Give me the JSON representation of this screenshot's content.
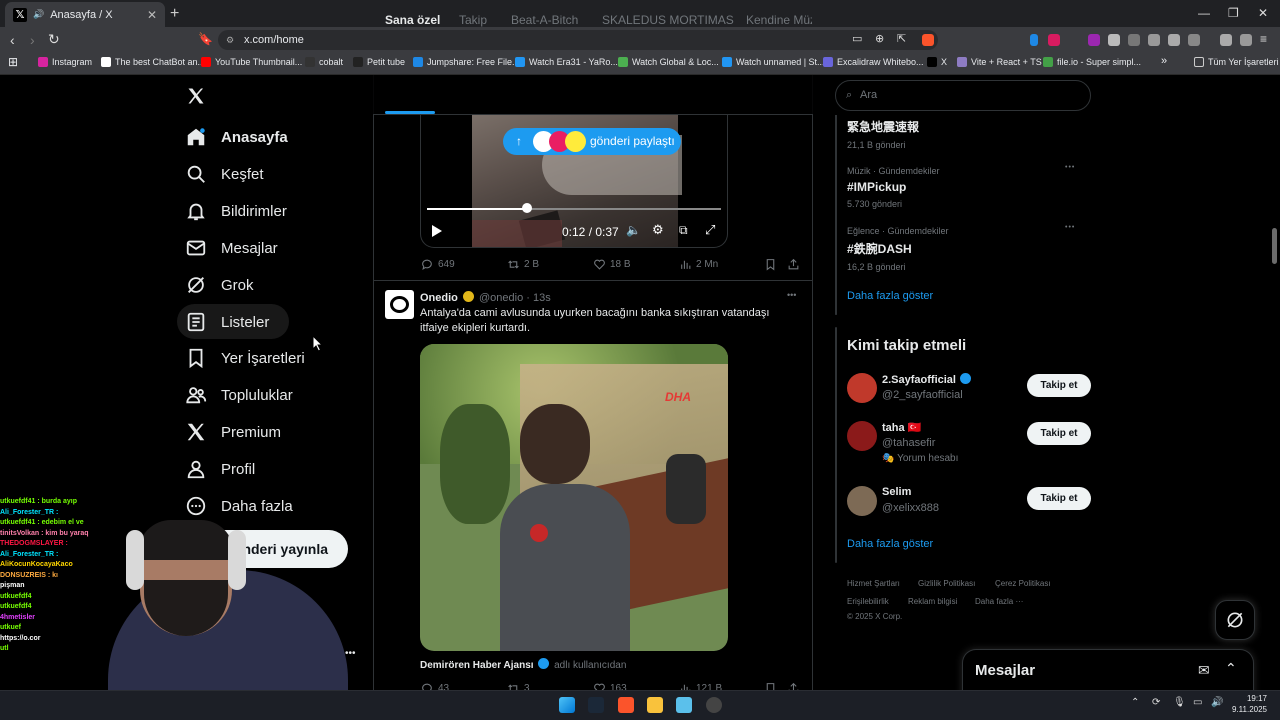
{
  "browser": {
    "tab_title": "Anasayfa / X",
    "tab_close": "✕",
    "new_tab": "+",
    "url": "x.com/home",
    "bookmarks": [
      {
        "label": "Instagram",
        "color": "#d6249f"
      },
      {
        "label": "The best ChatBot an...",
        "color": "#ffffff"
      },
      {
        "label": "YouTube Thumbnail...",
        "color": "#ff0000"
      },
      {
        "label": "cobalt",
        "color": "#333333"
      },
      {
        "label": "Petit tube",
        "color": "#222222"
      },
      {
        "label": "Jumpshare: Free File...",
        "color": "#1e88e5"
      },
      {
        "label": "Watch Era31 - YaRo...",
        "color": "#2196f3"
      },
      {
        "label": "Watch Global & Loc...",
        "color": "#4caf50"
      },
      {
        "label": "Watch unnamed | St...",
        "color": "#2196f3"
      },
      {
        "label": "Excalidraw Whitebo...",
        "color": "#6965db"
      },
      {
        "label": "X",
        "color": "#000000"
      },
      {
        "label": "Vite + React + TS",
        "color": "#8e7cc3"
      },
      {
        "label": "file.io - Super simpl...",
        "color": "#43a047"
      }
    ],
    "bookmarks_overflow": "»",
    "all_bookmarks": "Tüm Yer İşaretleri"
  },
  "sidebar": {
    "items": [
      {
        "label": "Anasayfa",
        "icon": "home-icon"
      },
      {
        "label": "Keşfet",
        "icon": "search-icon"
      },
      {
        "label": "Bildirimler",
        "icon": "bell-icon"
      },
      {
        "label": "Mesajlar",
        "icon": "mail-icon"
      },
      {
        "label": "Grok",
        "icon": "grok-icon"
      },
      {
        "label": "Listeler",
        "icon": "list-icon"
      },
      {
        "label": "Yer İşaretleri",
        "icon": "bookmark-icon"
      },
      {
        "label": "Topluluklar",
        "icon": "people-icon"
      },
      {
        "label": "Premium",
        "icon": "x-logo-icon"
      },
      {
        "label": "Profil",
        "icon": "user-icon"
      },
      {
        "label": "Daha fazla",
        "icon": "more-circle-icon"
      }
    ],
    "post_button": "Gönderi yayınla",
    "more_dots": "•••"
  },
  "timeline": {
    "tabs": [
      "Sana özel",
      "Takip",
      "Beat-A-Bitch",
      "SKALEDUS MORTIMAS",
      "Kendine Müz"
    ],
    "share_pill": "gönderi paylaştı",
    "video_time": "0:12 / 0:37",
    "tweet1_stats": {
      "replies": "649",
      "reposts": "2 B",
      "likes": "18 B",
      "views": "2 Mn"
    },
    "tweet2": {
      "name": "Onedio",
      "handle": "@onedio",
      "time": "· 13s",
      "more": "•••",
      "text": "Antalya'da cami avlusunda uyurken bacağını banka sıkıştıran vatandaşı itfaiye ekipleri kurtardı.",
      "media_watermark": "DHA",
      "source": "Demirören Haber Ajansı",
      "source_suffix": "adlı kullanıcıdan",
      "stats": {
        "replies": "43",
        "reposts": "3",
        "likes": "163",
        "views": "121 B"
      }
    }
  },
  "right": {
    "search_placeholder": "Ara",
    "trends": [
      {
        "meta": "",
        "name": "緊急地震速報",
        "count": "21,1 B gönderi"
      },
      {
        "meta": "Müzik · Gündemdekiler",
        "name": "#IMPickup",
        "count": "5.730 gönderi"
      },
      {
        "meta": "Eğlence · Gündemdekiler",
        "name": "#鉄腕DASH",
        "count": "16,2 B gönderi"
      }
    ],
    "show_more": "Daha fazla göster",
    "who_to_follow_title": "Kimi takip etmeli",
    "who_to_follow": [
      {
        "name": "2.Sayfaofficial",
        "handle": "@2_sayfaofficial",
        "sub": "",
        "color": "#c0392b"
      },
      {
        "name": "taha 🇹🇷",
        "handle": "@tahasefir",
        "sub": "Yorum hesabı",
        "color": "#8b1a1a"
      },
      {
        "name": "Selim",
        "handle": "@xelixx888",
        "sub": "",
        "color": "#7d6a55"
      }
    ],
    "follow_label": "Takip et",
    "footer": [
      "Hizmet Şartları",
      "Gizlilik Politikası",
      "Çerez Politikası",
      "Erişilebilirlik",
      "Reklam bilgisi",
      "Daha fazla ···",
      "© 2025 X Corp."
    ]
  },
  "messages_drawer": {
    "title": "Mesajlar"
  },
  "stream_chat": [
    {
      "text": "utkuefdf41 : burda ayıp",
      "color": "#76ff03"
    },
    {
      "text": "Ali_Forester_TR :",
      "color": "#00e5ff"
    },
    {
      "text": "utkuefdf41 : edebim el ve",
      "color": "#76ff03"
    },
    {
      "text": "tinitsVolkan : kim bu yaraq",
      "color": "#ff80ab"
    },
    {
      "text": "THEDOGMSLAYER :",
      "color": "#ff1744"
    },
    {
      "text": "Ali_Forester_TR :",
      "color": "#00e5ff"
    },
    {
      "text": "AliKocunKocayaKaco",
      "color": "#ffd600"
    },
    {
      "text": "DONSUZREIS : kı",
      "color": "#ffab40"
    },
    {
      "text": "pişman",
      "color": "#ffffff"
    },
    {
      "text": "utkuefdf4",
      "color": "#76ff03"
    },
    {
      "text": "utkuefdf4",
      "color": "#76ff03"
    },
    {
      "text": "4hmetisler",
      "color": "#e040fb"
    },
    {
      "text": "utkuef",
      "color": "#76ff03"
    },
    {
      "text": "https://o.cor",
      "color": "#ffffff"
    },
    {
      "text": "utl",
      "color": "#76ff03"
    }
  ],
  "clock": {
    "time": "19:17",
    "date": "9.11.2025"
  }
}
